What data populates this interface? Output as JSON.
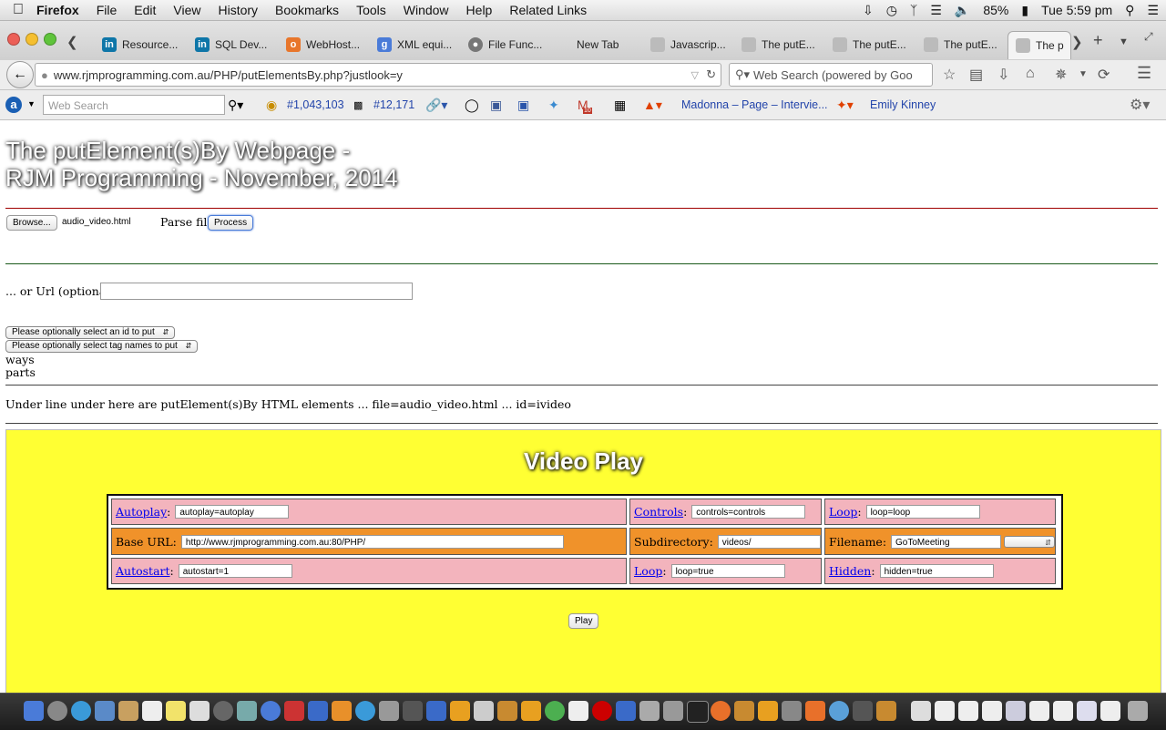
{
  "menubar": {
    "app": "Firefox",
    "items": [
      "File",
      "Edit",
      "View",
      "History",
      "Bookmarks",
      "Tools",
      "Window",
      "Help",
      "Related Links"
    ],
    "battery": "85%",
    "clock": "Tue 5:59 pm"
  },
  "tabs": [
    {
      "label": "Resource...",
      "icon": "linkedin-icon",
      "color": "#0e76a8"
    },
    {
      "label": "SQL Dev...",
      "icon": "linkedin-icon",
      "color": "#0e76a8"
    },
    {
      "label": "WebHost...",
      "icon": "webhost-icon",
      "color": "#e8762b"
    },
    {
      "label": "XML equi...",
      "icon": "google-icon",
      "color": "#4a7bd8"
    },
    {
      "label": "File Func...",
      "icon": "globe-icon",
      "color": "#777"
    },
    {
      "label": "New Tab",
      "icon": "",
      "color": ""
    },
    {
      "label": "Javascrip...",
      "icon": "page-icon",
      "color": "#999"
    },
    {
      "label": "The putE...",
      "icon": "page-icon",
      "color": "#999"
    },
    {
      "label": "The putE...",
      "icon": "page-icon",
      "color": "#999"
    },
    {
      "label": "The putE...",
      "icon": "page-icon",
      "color": "#999"
    },
    {
      "label": "The p",
      "icon": "page-icon",
      "color": "#999"
    }
  ],
  "nav": {
    "url": "www.rjmprogramming.com.au/PHP/putElementsBy.php?justlook=y",
    "search_placeholder": "Web Search (powered by Goo"
  },
  "addonbar": {
    "search_placeholder": "Web Search",
    "rank1": "#1,043,103",
    "rank2": "#12,171",
    "mail_badge": "10",
    "news": "Madonna – Page – Intervie...",
    "user": "Emily Kinney"
  },
  "page": {
    "title_line1": "The putElement(s)By Webpage -",
    "title_line2": "RJM Programming - November, 2014",
    "browse_label": "Browse...",
    "filename": "audio_video.html",
    "parse_label": "Parse file:",
    "process_label": "Process",
    "url_label": "... or Url (optional):",
    "url_value": "",
    "select_id": "Please optionally select an id to put",
    "select_tags": "Please optionally select tag names to put",
    "ways": "ways",
    "parts": "parts",
    "info_line": "Under line under here are putElement(s)By HTML elements ... file=audio_video.html ... id=ivideo"
  },
  "video": {
    "title": "Video Play",
    "row1": {
      "c1_label": "Autoplay",
      "c1_value": "autoplay=autoplay",
      "c2_label": "Controls",
      "c2_value": "controls=controls",
      "c3_label": "Loop",
      "c3_value": "loop=loop"
    },
    "row2": {
      "c1_label": "Base URL:",
      "c1_value": "http://www.rjmprogramming.com.au:80/PHP/",
      "c2_label": "Subdirectory:",
      "c2_value": "videos/",
      "c3_label": "Filename:",
      "c3_value": "GoToMeeting",
      "c3_select": ""
    },
    "row3": {
      "c1_label": "Autostart",
      "c1_value": "autostart=1",
      "c2_label": "Loop",
      "c2_value": "loop=true",
      "c3_label": "Hidden",
      "c3_value": "hidden=true"
    },
    "play_label": "Play"
  },
  "colors": {
    "yellow_bg": "#ffff33",
    "pink_cell": "#f3b4bd",
    "orange_cell": "#f0922a",
    "red_rule": "#a00000",
    "green_rule": "#1a5a1a"
  }
}
